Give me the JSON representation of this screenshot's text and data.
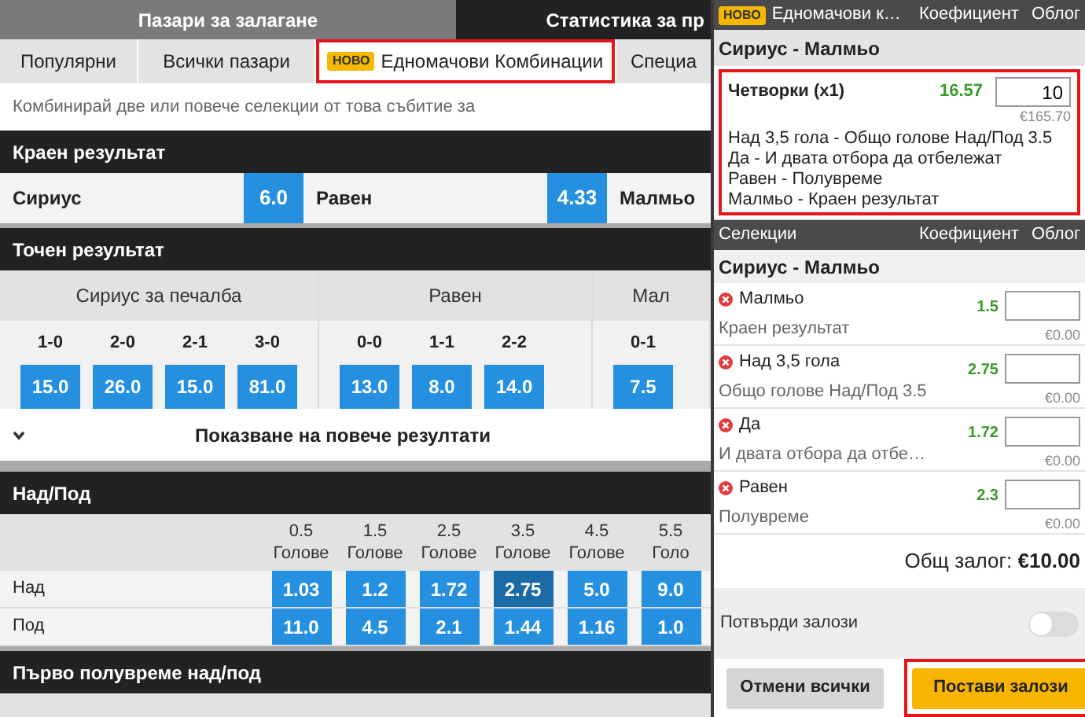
{
  "top_tabs": [
    {
      "label": "Пазари за залагане",
      "selected": true
    },
    {
      "label": "Статистика за пр",
      "selected": false
    }
  ],
  "market_tabs": [
    {
      "label": "Популярни",
      "selected": false,
      "highlighted": false
    },
    {
      "label": "Всички пазари",
      "selected": false,
      "highlighted": false
    },
    {
      "badge": "НОВО",
      "label": "Едномачови Комбинации",
      "selected": true,
      "highlighted": true
    },
    {
      "label": "Специа",
      "selected": false,
      "highlighted": false
    }
  ],
  "description": "Комбинирай две или повече селекции от това събитие за",
  "match_result": {
    "title": "Краен результат",
    "outcomes": [
      {
        "name": "Сириус",
        "odds": "6.0"
      },
      {
        "name": "Равен",
        "odds": "4.33"
      },
      {
        "name": "Малмьо"
      }
    ]
  },
  "correct_score": {
    "title": "Точен результат",
    "groups": [
      {
        "label": "Сириус за печалба",
        "scores": [
          {
            "score": "1-0",
            "odds": "15.0"
          },
          {
            "score": "2-0",
            "odds": "26.0"
          },
          {
            "score": "2-1",
            "odds": "15.0"
          },
          {
            "score": "3-0",
            "odds": "81.0"
          }
        ]
      },
      {
        "label": "Равен",
        "scores": [
          {
            "score": "0-0",
            "odds": "13.0"
          },
          {
            "score": "1-1",
            "odds": "8.0"
          },
          {
            "score": "2-2",
            "odds": "14.0"
          }
        ]
      },
      {
        "label": "Мал",
        "scores": [
          {
            "score": "0-1",
            "odds": "7.5"
          }
        ]
      }
    ],
    "show_more": "Показване на повече резултати"
  },
  "over_under": {
    "title": "Над/Под",
    "columns": [
      {
        "line": "0.5",
        "unit": "Голове"
      },
      {
        "line": "1.5",
        "unit": "Голове"
      },
      {
        "line": "2.5",
        "unit": "Голове"
      },
      {
        "line": "3.5",
        "unit": "Голове"
      },
      {
        "line": "4.5",
        "unit": "Голове"
      },
      {
        "line": "5.5",
        "unit": "Голо"
      }
    ],
    "rows": [
      {
        "label": "Над",
        "odds": [
          {
            "value": "1.03",
            "selected": false
          },
          {
            "value": "1.2",
            "selected": false
          },
          {
            "value": "1.72",
            "selected": false
          },
          {
            "value": "2.75",
            "selected": true
          },
          {
            "value": "5.0",
            "selected": false
          },
          {
            "value": "9.0",
            "selected": false
          }
        ]
      },
      {
        "label": "Под",
        "odds": [
          {
            "value": "11.0",
            "selected": false
          },
          {
            "value": "4.5",
            "selected": false
          },
          {
            "value": "2.1",
            "selected": false
          },
          {
            "value": "1.44",
            "selected": false
          },
          {
            "value": "1.16",
            "selected": false
          },
          {
            "value": "1.0",
            "selected": false
          }
        ]
      }
    ]
  },
  "first_half_over_under": {
    "title": "Първо полувреме над/под"
  },
  "bet_slip": {
    "header": {
      "badge": "НОВО",
      "title": "Едномачови к…",
      "odds_label": "Коефициент",
      "stake_label": "Облог"
    },
    "event": "Сириус - Малмьо",
    "combo": {
      "highlighted": true,
      "name": "Четворки (x1)",
      "odds": "16.57",
      "stake": "10",
      "returns": "€165.70",
      "legs": [
        "Над 3,5 гола - Общо голове Над/Под 3.5",
        "Да - И двата отбора да отбележат",
        "Равен - Полувреме",
        "Малмьо - Краен результат"
      ]
    },
    "selections_header": {
      "title": "Селекции",
      "odds_label": "Коефициент",
      "stake_label": "Облог"
    },
    "selections_event": "Сириус - Малмьо",
    "selections": [
      {
        "name": "Малмьо",
        "market": "Краен результат",
        "odds": "1.5",
        "returns": "€0.00"
      },
      {
        "name": "Над 3,5 гола",
        "market": "Общо голове Над/Под 3.5",
        "odds": "2.75",
        "returns": "€0.00"
      },
      {
        "name": "Да",
        "market": "И двата отбора да отбе…",
        "odds": "1.72",
        "returns": "€0.00"
      },
      {
        "name": "Равен",
        "market": "Полувреме",
        "odds": "2.3",
        "returns": "€0.00"
      }
    ],
    "total": "Общ залог: **€10.00**",
    "confirm": {
      "label": "Потвърди залози",
      "on": false
    },
    "buttons": [
      {
        "kind": "secondary",
        "label": "Отмени всички",
        "highlighted": false
      },
      {
        "kind": "primary",
        "label": "Постави залози",
        "highlighted": true
      }
    ]
  }
}
